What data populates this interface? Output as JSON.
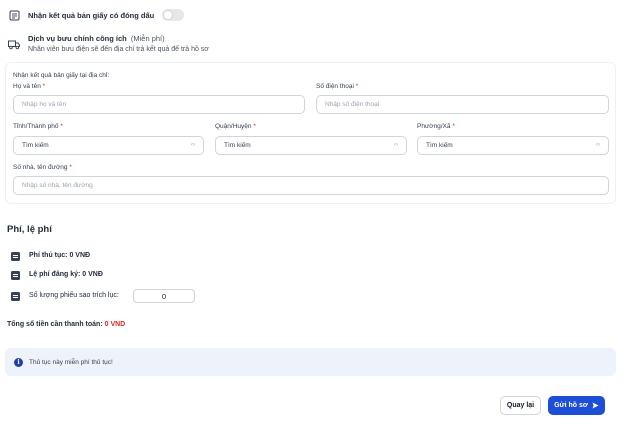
{
  "paper_result": {
    "label": "Nhận kết quả bản giấy có đóng dấu",
    "enabled": false
  },
  "postal": {
    "title": "Dịch vụ bưu chính công ích",
    "badge": "(Miễn phí)",
    "description": "Nhân viên bưu điện sẽ đến địa chỉ trả kết quả để trả hồ sơ",
    "enabled": true
  },
  "address": {
    "heading": "Nhận kết quả bản giấy tại địa chỉ:",
    "name": {
      "label": "Họ và tên",
      "placeholder": "Nhập họ và tên"
    },
    "phone": {
      "label": "Số điện thoại",
      "placeholder": "Nhập số điện thoại"
    },
    "province": {
      "label": "Tỉnh/Thành phố",
      "value": "Tìm kiếm"
    },
    "district": {
      "label": "Quận/Huyện",
      "value": "Tìm kiếm"
    },
    "ward": {
      "label": "Phường/Xã",
      "value": "Tìm kiếm"
    },
    "street": {
      "label": "Số nhà, tên đường",
      "placeholder": "Nhập số nhà, tên đường"
    },
    "required_mark": "*"
  },
  "fees": {
    "heading": "Phí, lệ phí",
    "procedure_fee": "Phí thủ tục: 0 VNĐ",
    "registration_fee": "Lệ phí đăng ký: 0 VNĐ",
    "copies_label": "Số lượng phiếu sao trích lục:",
    "copies_value": "0",
    "total_label": "Tổng số tiền cần thanh toán:",
    "total_value": "0 VND"
  },
  "note": "Thủ tục này miễn phí thủ tục!",
  "actions": {
    "back": "Quay lại",
    "submit": "Gửi hồ sơ",
    "submit_icon": "send-icon"
  },
  "colors": {
    "primary": "#1d4ed8",
    "total": "#dc2626",
    "note_bg": "#eef3fb"
  }
}
